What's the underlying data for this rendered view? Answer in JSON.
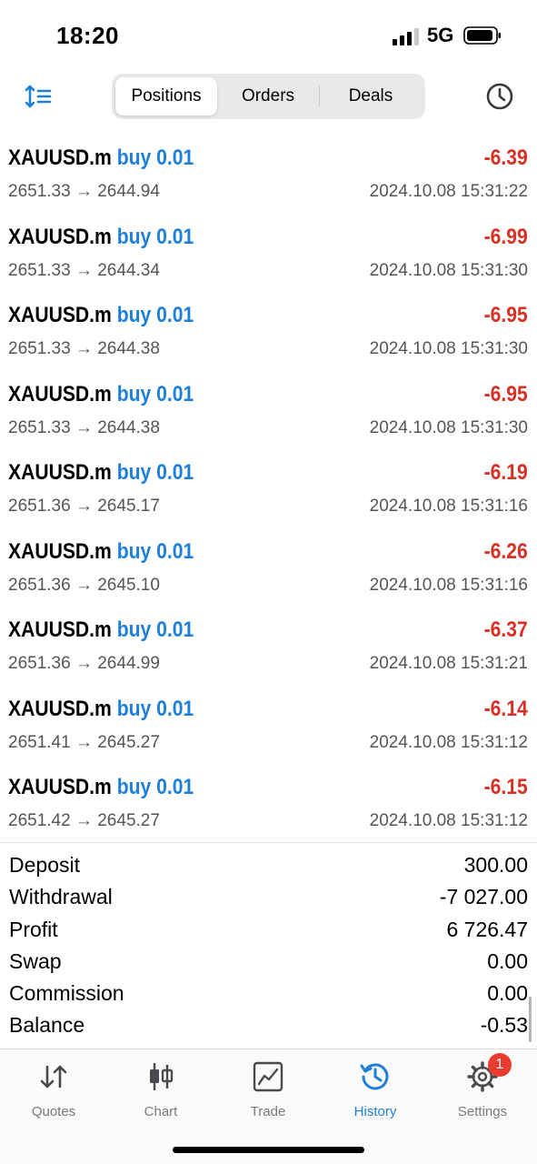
{
  "status_bar": {
    "time": "18:20",
    "network": "5G"
  },
  "toolbar": {
    "tabs": [
      {
        "label": "Positions",
        "active": true
      },
      {
        "label": "Orders",
        "active": false
      },
      {
        "label": "Deals",
        "active": false
      }
    ],
    "sort_icon": "sort-icon",
    "history_icon": "clock-icon"
  },
  "deals": [
    {
      "symbol": "XAUUSD.m",
      "side": "buy 0.01",
      "profit": "-6.39",
      "prices": "2651.33 → 2644.94",
      "time": "2024.10.08 15:31:22"
    },
    {
      "symbol": "XAUUSD.m",
      "side": "buy 0.01",
      "profit": "-6.99",
      "prices": "2651.33 → 2644.34",
      "time": "2024.10.08 15:31:30"
    },
    {
      "symbol": "XAUUSD.m",
      "side": "buy 0.01",
      "profit": "-6.95",
      "prices": "2651.33 → 2644.38",
      "time": "2024.10.08 15:31:30"
    },
    {
      "symbol": "XAUUSD.m",
      "side": "buy 0.01",
      "profit": "-6.95",
      "prices": "2651.33 → 2644.38",
      "time": "2024.10.08 15:31:30"
    },
    {
      "symbol": "XAUUSD.m",
      "side": "buy 0.01",
      "profit": "-6.19",
      "prices": "2651.36 → 2645.17",
      "time": "2024.10.08 15:31:16"
    },
    {
      "symbol": "XAUUSD.m",
      "side": "buy 0.01",
      "profit": "-6.26",
      "prices": "2651.36 → 2645.10",
      "time": "2024.10.08 15:31:16"
    },
    {
      "symbol": "XAUUSD.m",
      "side": "buy 0.01",
      "profit": "-6.37",
      "prices": "2651.36 → 2644.99",
      "time": "2024.10.08 15:31:21"
    },
    {
      "symbol": "XAUUSD.m",
      "side": "buy 0.01",
      "profit": "-6.14",
      "prices": "2651.41 → 2645.27",
      "time": "2024.10.08 15:31:12"
    },
    {
      "symbol": "XAUUSD.m",
      "side": "buy 0.01",
      "profit": "-6.15",
      "prices": "2651.42 → 2645.27",
      "time": "2024.10.08 15:31:12"
    }
  ],
  "summary": [
    {
      "label": "Deposit",
      "value": "300.00"
    },
    {
      "label": "Withdrawal",
      "value": "-7 027.00"
    },
    {
      "label": "Profit",
      "value": "6 726.47"
    },
    {
      "label": "Swap",
      "value": "0.00"
    },
    {
      "label": "Commission",
      "value": "0.00"
    },
    {
      "label": "Balance",
      "value": "-0.53"
    }
  ],
  "tabbar": {
    "items": [
      {
        "label": "Quotes",
        "icon": "quotes-icon",
        "active": false
      },
      {
        "label": "Chart",
        "icon": "chart-icon",
        "active": false
      },
      {
        "label": "Trade",
        "icon": "trade-icon",
        "active": false
      },
      {
        "label": "History",
        "icon": "history-icon",
        "active": true
      },
      {
        "label": "Settings",
        "icon": "settings-icon",
        "active": false,
        "badge": "1"
      }
    ]
  },
  "colors": {
    "accent": "#1e7fd8",
    "loss": "#d93025",
    "badge": "#ea3b30"
  }
}
